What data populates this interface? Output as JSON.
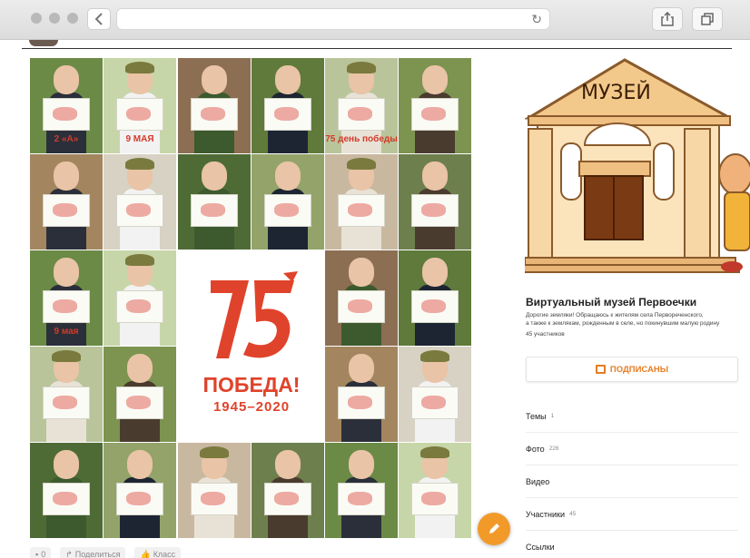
{
  "browser": {
    "back_icon": "chevron-left-icon",
    "reload_icon": "reload-icon",
    "share_icon": "share-icon",
    "tabs_icon": "tabs-icon"
  },
  "collage": {
    "logo_number": "75",
    "logo_word": "ПОБЕДА!",
    "logo_years": "1945–2020",
    "caption_class": "2 «А»",
    "caption_may9_a": "9 МАЯ",
    "caption_may9_b": "9 мая",
    "caption_75_day": "75 день победы"
  },
  "post_actions": {
    "comments_count": "0",
    "share_label": "Поделиться",
    "like_label": "Класс"
  },
  "group": {
    "museum_sign": "МУЗЕЙ",
    "title": "Виртуальный музей Первоечки",
    "description_line1": "Дорогие земляки! Обращаюсь к жителям села Первореченского,",
    "description_line2": "а также к землякам, рожденным в селе, но покинувшим малую родину",
    "members": "45 участников",
    "subscribed_label": "ПОДПИСАНЫ",
    "menu": [
      {
        "label": "Темы",
        "count": "1"
      },
      {
        "label": "Фото",
        "count": "226"
      },
      {
        "label": "Видео",
        "count": ""
      },
      {
        "label": "Участники",
        "count": "45"
      },
      {
        "label": "Ссылки",
        "count": ""
      }
    ]
  },
  "colors": {
    "accent_orange": "#f29a29",
    "victory_red": "#e0432b",
    "subscribed_orange": "#e47d22"
  }
}
